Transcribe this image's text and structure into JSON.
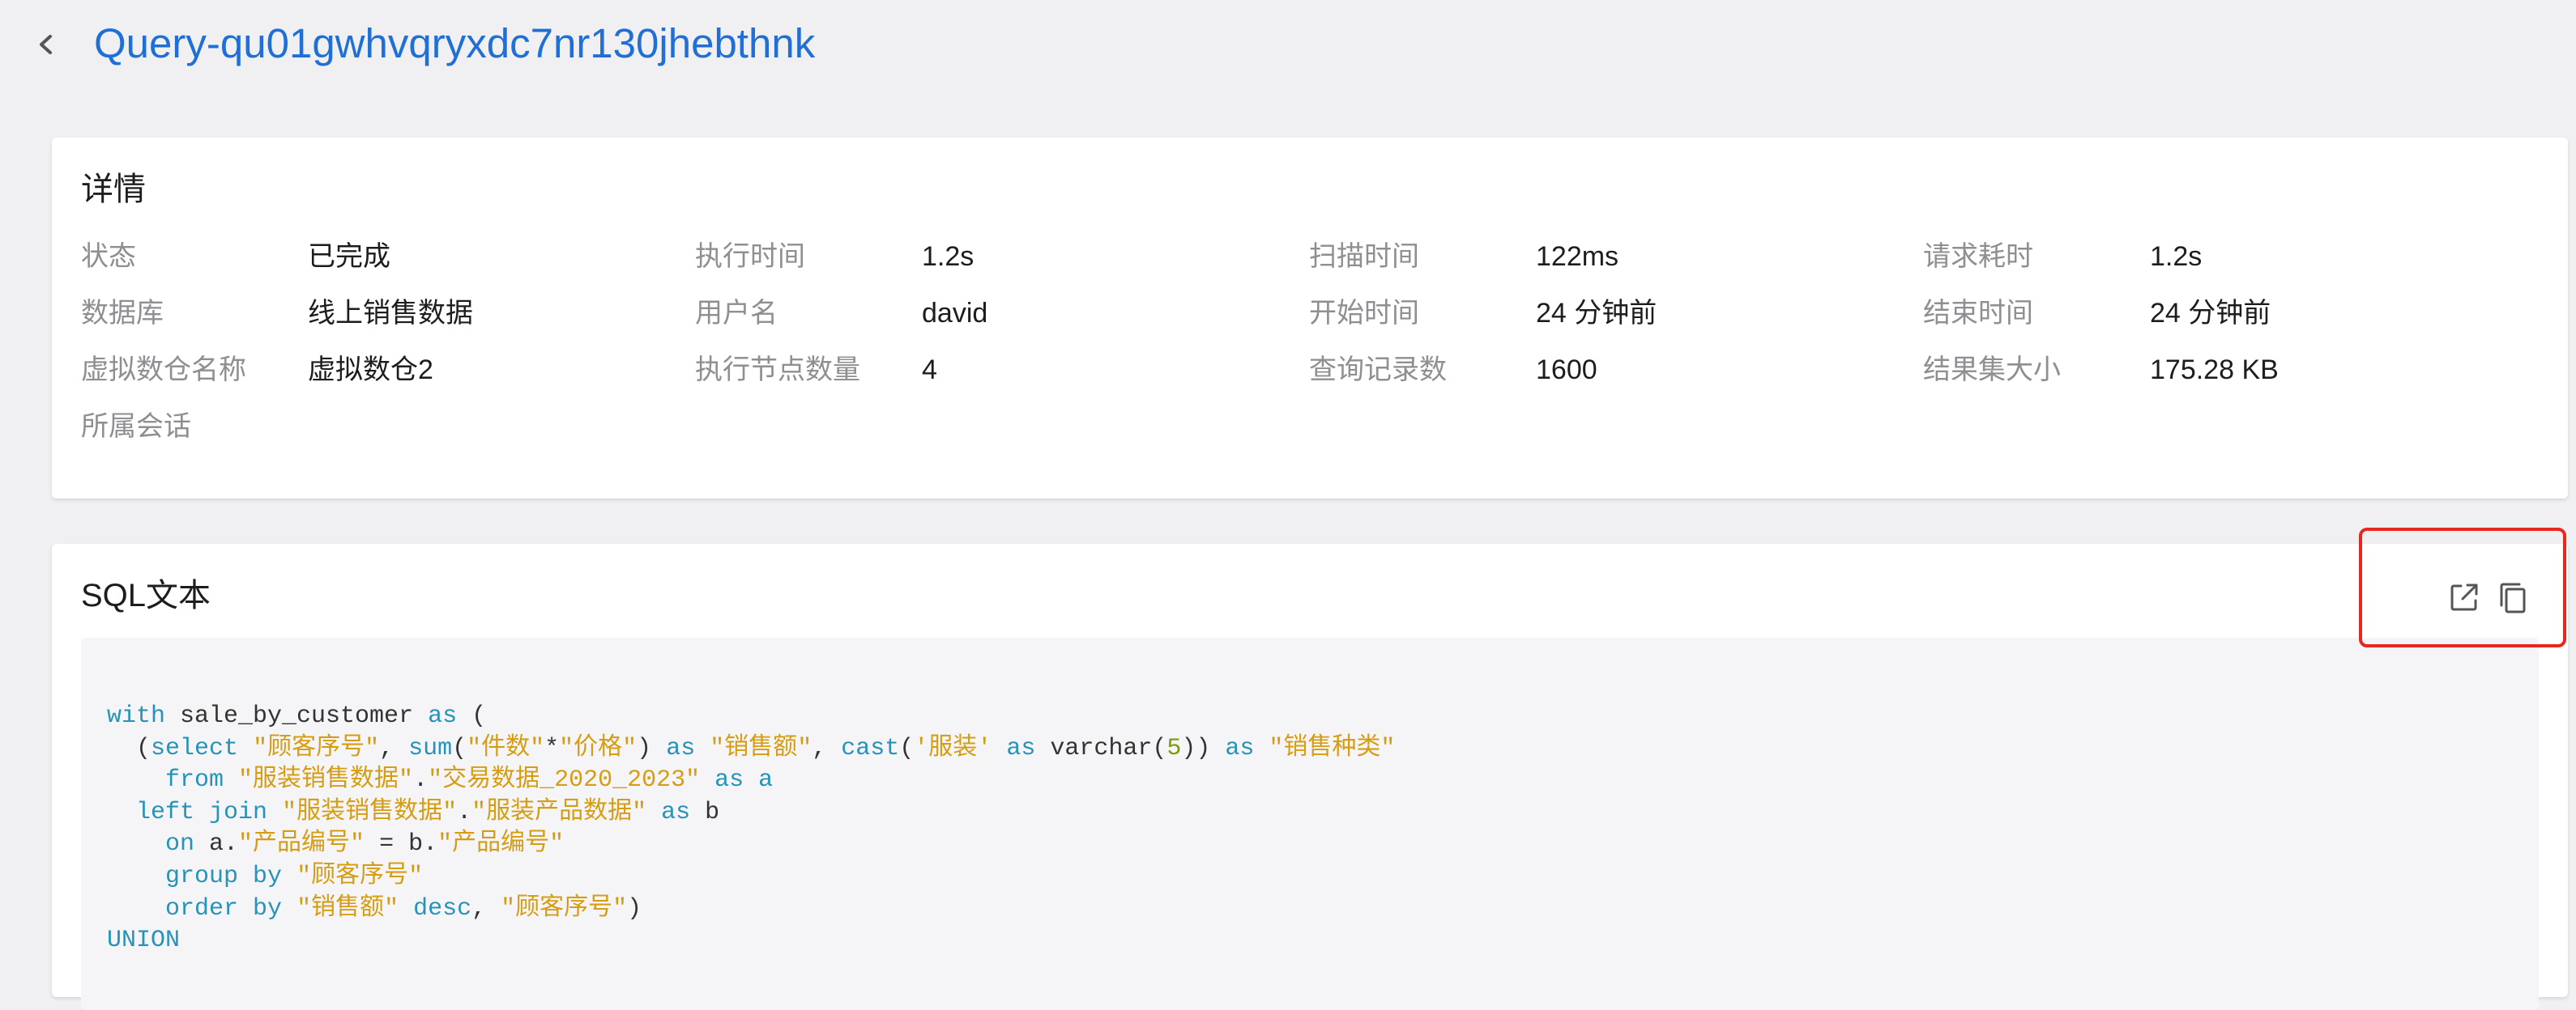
{
  "header": {
    "title": "Query-qu01gwhvqryxdc7nr130jhebthnk"
  },
  "details": {
    "title": "详情",
    "rows": [
      [
        {
          "label": "状态",
          "value": "已完成"
        },
        {
          "label": "执行时间",
          "value": "1.2s"
        },
        {
          "label": "扫描时间",
          "value": "122ms"
        },
        {
          "label": "请求耗时",
          "value": "1.2s"
        }
      ],
      [
        {
          "label": "数据库",
          "value": "线上销售数据"
        },
        {
          "label": "用户名",
          "value": "david"
        },
        {
          "label": "开始时间",
          "value": "24 分钟前"
        },
        {
          "label": "结束时间",
          "value": "24 分钟前"
        }
      ],
      [
        {
          "label": "虚拟数仓名称",
          "value": "虚拟数仓2"
        },
        {
          "label": "执行节点数量",
          "value": "4"
        },
        {
          "label": "查询记录数",
          "value": "1600"
        },
        {
          "label": "结果集大小",
          "value": "175.28 KB"
        }
      ],
      [
        {
          "label": "所属会话",
          "value": ""
        }
      ]
    ]
  },
  "sql": {
    "title": "SQL文本",
    "icons": {
      "open": "external-link-icon",
      "copy": "copy-icon"
    },
    "lines": [
      [
        {
          "t": "kw",
          "v": "with"
        },
        {
          "t": "plain",
          "v": " sale_by_customer "
        },
        {
          "t": "kw",
          "v": "as"
        },
        {
          "t": "plain",
          "v": " ("
        }
      ],
      [
        {
          "t": "plain",
          "v": "  ("
        },
        {
          "t": "kw",
          "v": "select"
        },
        {
          "t": "plain",
          "v": " "
        },
        {
          "t": "str",
          "v": "\"顾客序号\""
        },
        {
          "t": "plain",
          "v": ", "
        },
        {
          "t": "kw",
          "v": "sum"
        },
        {
          "t": "plain",
          "v": "("
        },
        {
          "t": "str",
          "v": "\"件数\""
        },
        {
          "t": "plain",
          "v": "*"
        },
        {
          "t": "str",
          "v": "\"价格\""
        },
        {
          "t": "plain",
          "v": ") "
        },
        {
          "t": "kw",
          "v": "as"
        },
        {
          "t": "plain",
          "v": " "
        },
        {
          "t": "str",
          "v": "\"销售额\""
        },
        {
          "t": "plain",
          "v": ", "
        },
        {
          "t": "kw",
          "v": "cast"
        },
        {
          "t": "plain",
          "v": "("
        },
        {
          "t": "str",
          "v": "'服装'"
        },
        {
          "t": "plain",
          "v": " "
        },
        {
          "t": "kw",
          "v": "as"
        },
        {
          "t": "plain",
          "v": " varchar("
        },
        {
          "t": "num",
          "v": "5"
        },
        {
          "t": "plain",
          "v": ")) "
        },
        {
          "t": "kw",
          "v": "as"
        },
        {
          "t": "plain",
          "v": " "
        },
        {
          "t": "str",
          "v": "\"销售种类\""
        }
      ],
      [
        {
          "t": "plain",
          "v": "    "
        },
        {
          "t": "kw",
          "v": "from"
        },
        {
          "t": "plain",
          "v": " "
        },
        {
          "t": "str",
          "v": "\"服装销售数据\""
        },
        {
          "t": "plain",
          "v": "."
        },
        {
          "t": "str",
          "v": "\"交易数据_2020_2023\""
        },
        {
          "t": "plain",
          "v": " "
        },
        {
          "t": "kw",
          "v": "as"
        },
        {
          "t": "plain",
          "v": " "
        },
        {
          "t": "kw",
          "v": "a"
        }
      ],
      [
        {
          "t": "plain",
          "v": "  "
        },
        {
          "t": "kw",
          "v": "left join"
        },
        {
          "t": "plain",
          "v": " "
        },
        {
          "t": "str",
          "v": "\"服装销售数据\""
        },
        {
          "t": "plain",
          "v": "."
        },
        {
          "t": "str",
          "v": "\"服装产品数据\""
        },
        {
          "t": "plain",
          "v": " "
        },
        {
          "t": "kw",
          "v": "as"
        },
        {
          "t": "plain",
          "v": " b"
        }
      ],
      [
        {
          "t": "plain",
          "v": "    "
        },
        {
          "t": "kw",
          "v": "on"
        },
        {
          "t": "plain",
          "v": " a."
        },
        {
          "t": "str",
          "v": "\"产品编号\""
        },
        {
          "t": "plain",
          "v": " = b."
        },
        {
          "t": "str",
          "v": "\"产品编号\""
        }
      ],
      [
        {
          "t": "plain",
          "v": "    "
        },
        {
          "t": "kw",
          "v": "group by"
        },
        {
          "t": "plain",
          "v": " "
        },
        {
          "t": "str",
          "v": "\"顾客序号\""
        }
      ],
      [
        {
          "t": "plain",
          "v": "    "
        },
        {
          "t": "kw",
          "v": "order by"
        },
        {
          "t": "plain",
          "v": " "
        },
        {
          "t": "str",
          "v": "\"销售额\""
        },
        {
          "t": "plain",
          "v": " "
        },
        {
          "t": "kw",
          "v": "desc"
        },
        {
          "t": "plain",
          "v": ", "
        },
        {
          "t": "str",
          "v": "\"顾客序号\""
        },
        {
          "t": "plain",
          "v": ")"
        }
      ],
      [
        {
          "t": "kw",
          "v": "UNION"
        }
      ]
    ]
  }
}
